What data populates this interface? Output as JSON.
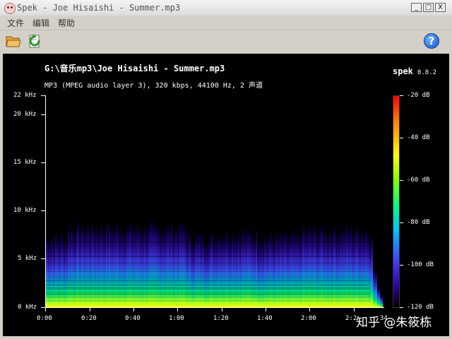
{
  "window": {
    "title": "Spek - Joe Hisaishi - Summer.mp3",
    "controls": [
      "_",
      "□",
      "X"
    ]
  },
  "menu": [
    "文件",
    "编辑",
    "帮助"
  ],
  "toolbar": {
    "open_icon": "folder-open-icon",
    "reload_icon": "reload-icon",
    "help_icon": "help-icon",
    "help_glyph": "?"
  },
  "spek": {
    "file_path": "G:\\音乐mp3\\Joe Hisaishi - Summer.mp3",
    "info": "MP3 (MPEG audio layer 3), 320 kbps, 44100 Hz, 2 声道",
    "brand": "spek",
    "version": "0.8.2",
    "y_labels": [
      "22 kHz",
      "20 kHz",
      "15 kHz",
      "10 kHz",
      "5 kHz",
      "0 kHz"
    ],
    "x_labels": [
      "0:00",
      "0:20",
      "0:40",
      "1:00",
      "1:20",
      "1:40",
      "2:00",
      "2:2",
      "34"
    ],
    "db_labels": [
      "-20 dB",
      "-40 dB",
      "-60 dB",
      "-80 dB",
      "-100 dB",
      "-120 dB"
    ]
  },
  "watermark": "知乎 @朱筱栋",
  "colors": {
    "background": "#000000",
    "window_chrome": "#d4d0c8",
    "colormap": [
      "#ff0000",
      "#ffff00",
      "#00ff80",
      "#00c0ff",
      "#4040ff",
      "#3000a0"
    ]
  }
}
